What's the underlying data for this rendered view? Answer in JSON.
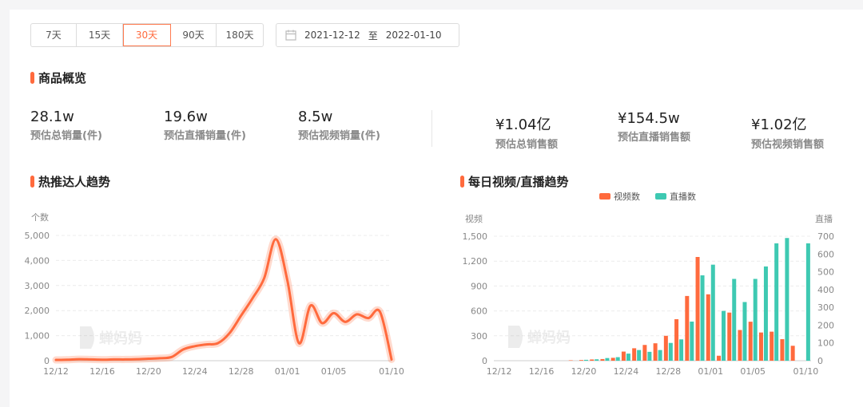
{
  "range_tabs": [
    {
      "label": "7天",
      "active": false
    },
    {
      "label": "15天",
      "active": false
    },
    {
      "label": "30天",
      "active": true
    },
    {
      "label": "90天",
      "active": false
    },
    {
      "label": "180天",
      "active": false
    }
  ],
  "date_range": {
    "start": "2021-12-12",
    "separator": "至",
    "end": "2022-01-10"
  },
  "overview": {
    "title": "商品概览",
    "metrics": [
      {
        "value": "28.1w",
        "label": "预估总销量(件)"
      },
      {
        "value": "19.6w",
        "label": "预估直播销量(件)"
      },
      {
        "value": "8.5w",
        "label": "预估视频销量(件)"
      },
      {
        "value": "¥1.04亿",
        "label": "预估总销售额"
      },
      {
        "value": "¥154.5w",
        "label": "预估直播销售额"
      },
      {
        "value": "¥1.02亿",
        "label": "预估视频销售额"
      }
    ]
  },
  "watermark": "蝉妈妈",
  "accent": "#ff6a3d",
  "chart_data": [
    {
      "type": "line",
      "title": "热推达人趋势",
      "ylabel": "个数",
      "ylim": [
        0,
        5000
      ],
      "yticks": [
        "0",
        "1,000",
        "2,000",
        "3,000",
        "4,000",
        "5,000"
      ],
      "xticks": [
        "12/12",
        "12/16",
        "12/20",
        "12/24",
        "12/28",
        "01/01",
        "01/05",
        "01/10"
      ],
      "x": [
        "12/12",
        "12/13",
        "12/14",
        "12/15",
        "12/16",
        "12/17",
        "12/18",
        "12/19",
        "12/20",
        "12/21",
        "12/22",
        "12/23",
        "12/24",
        "12/25",
        "12/26",
        "12/27",
        "12/28",
        "12/29",
        "12/30",
        "12/31",
        "01/01",
        "01/02",
        "01/03",
        "01/04",
        "01/05",
        "01/06",
        "01/07",
        "01/08",
        "01/09",
        "01/10"
      ],
      "series": [
        {
          "color": "#ff6a3d",
          "values": [
            30,
            40,
            60,
            50,
            40,
            50,
            50,
            60,
            80,
            100,
            150,
            450,
            580,
            650,
            700,
            1100,
            1800,
            2500,
            3300,
            4850,
            3200,
            700,
            2200,
            1500,
            1900,
            1550,
            1850,
            1700,
            1950,
            50
          ]
        }
      ]
    },
    {
      "type": "bar",
      "title": "每日视频/直播趋势",
      "ylabel": "视频",
      "y2label": "直播",
      "ylim": [
        0,
        1500
      ],
      "y2lim": [
        0,
        700
      ],
      "yticks": [
        "0",
        "300",
        "600",
        "900",
        "1,200",
        "1,500"
      ],
      "y2ticks": [
        "0",
        "100",
        "200",
        "300",
        "400",
        "500",
        "600",
        "700"
      ],
      "xticks": [
        "12/12",
        "12/16",
        "12/20",
        "12/24",
        "12/28",
        "01/01",
        "01/05",
        "01/10"
      ],
      "x": [
        "12/12",
        "12/13",
        "12/14",
        "12/15",
        "12/16",
        "12/17",
        "12/18",
        "12/19",
        "12/20",
        "12/21",
        "12/22",
        "12/23",
        "12/24",
        "12/25",
        "12/26",
        "12/27",
        "12/28",
        "12/29",
        "12/30",
        "12/31",
        "01/01",
        "01/02",
        "01/03",
        "01/04",
        "01/05",
        "01/06",
        "01/07",
        "01/08",
        "01/09",
        "01/10"
      ],
      "legend": "top-center",
      "series": [
        {
          "name": "视频数",
          "color": "#ff6a3d",
          "axis": "left",
          "values": [
            0,
            0,
            0,
            0,
            0,
            0,
            0,
            5,
            8,
            15,
            20,
            35,
            110,
            150,
            190,
            210,
            300,
            500,
            780,
            1250,
            800,
            60,
            580,
            370,
            470,
            340,
            350,
            260,
            180,
            0
          ]
        },
        {
          "name": "直播数",
          "color": "#3ec9b2",
          "axis": "right",
          "values": [
            0,
            0,
            0,
            0,
            0,
            0,
            0,
            0,
            5,
            8,
            15,
            20,
            40,
            60,
            50,
            60,
            100,
            120,
            220,
            480,
            540,
            280,
            460,
            330,
            460,
            530,
            660,
            690,
            0,
            660
          ]
        }
      ]
    }
  ]
}
